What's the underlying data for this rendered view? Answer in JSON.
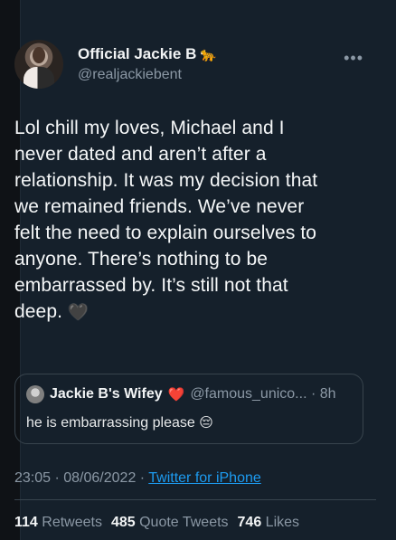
{
  "author": {
    "display_name": "Official Jackie B",
    "name_emoji": "🐆",
    "handle": "@realjackiebent"
  },
  "more_icon": "•••",
  "tweet": {
    "lines": [
      "Lol chill my loves, Michael and I",
      "never dated and aren’t after a",
      "relationship. It was my decision that",
      "we remained friends. We’ve never",
      "felt the need to explain ourselves to",
      "anyone. There’s nothing to be",
      "embarrassed by. It’s still not that",
      "deep."
    ],
    "end_emoji": "🖤"
  },
  "quoted": {
    "display_name": "Jackie B's Wifey",
    "name_emoji": "❤️",
    "handle_time": "@famous_unico... · 8h",
    "text": "he is embarrassing please",
    "text_emoji": "😔"
  },
  "meta": {
    "time_date": "23:05 · 08/06/2022 · ",
    "source": "Twitter for iPhone"
  },
  "stats": {
    "retweets_count": "114",
    "retweets_label": " Retweets",
    "quotes_count": "485",
    "quotes_label": " Quote Tweets",
    "likes_count": "746",
    "likes_label": " Likes"
  }
}
